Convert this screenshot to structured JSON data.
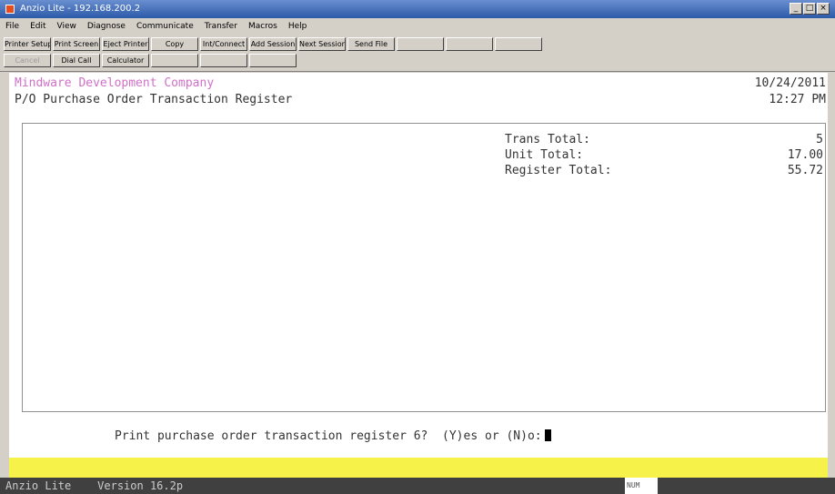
{
  "window": {
    "title": "Anzio Lite - 192.168.200.2"
  },
  "menu": [
    "File",
    "Edit",
    "View",
    "Diagnose",
    "Communicate",
    "Transfer",
    "Macros",
    "Help"
  ],
  "toolbar": {
    "row1": [
      "Printer Setup",
      "Print Screen",
      "Eject Printer",
      "Copy",
      "Int/Connect",
      "Add Session",
      "Next Session",
      "Send File",
      "",
      "",
      ""
    ],
    "row2": [
      "Cancel",
      "Dial Call",
      "Calculator",
      "",
      "",
      ""
    ]
  },
  "screen": {
    "company": "Mindware Development Company",
    "report_title": "P/O Purchase Order Transaction Register",
    "date": "10/24/2011",
    "time": "12:27 PM",
    "totals": [
      {
        "label": "Trans Total:",
        "value": "5"
      },
      {
        "label": "Unit Total:",
        "value": "17.00"
      },
      {
        "label": "Register Total:",
        "value": "55.72"
      }
    ],
    "prompt": "Print purchase order transaction register 6?  (Y)es or (N)o:"
  },
  "status": {
    "left": "Anzio Lite    Version 16.2p",
    "indicator": "NUM"
  }
}
